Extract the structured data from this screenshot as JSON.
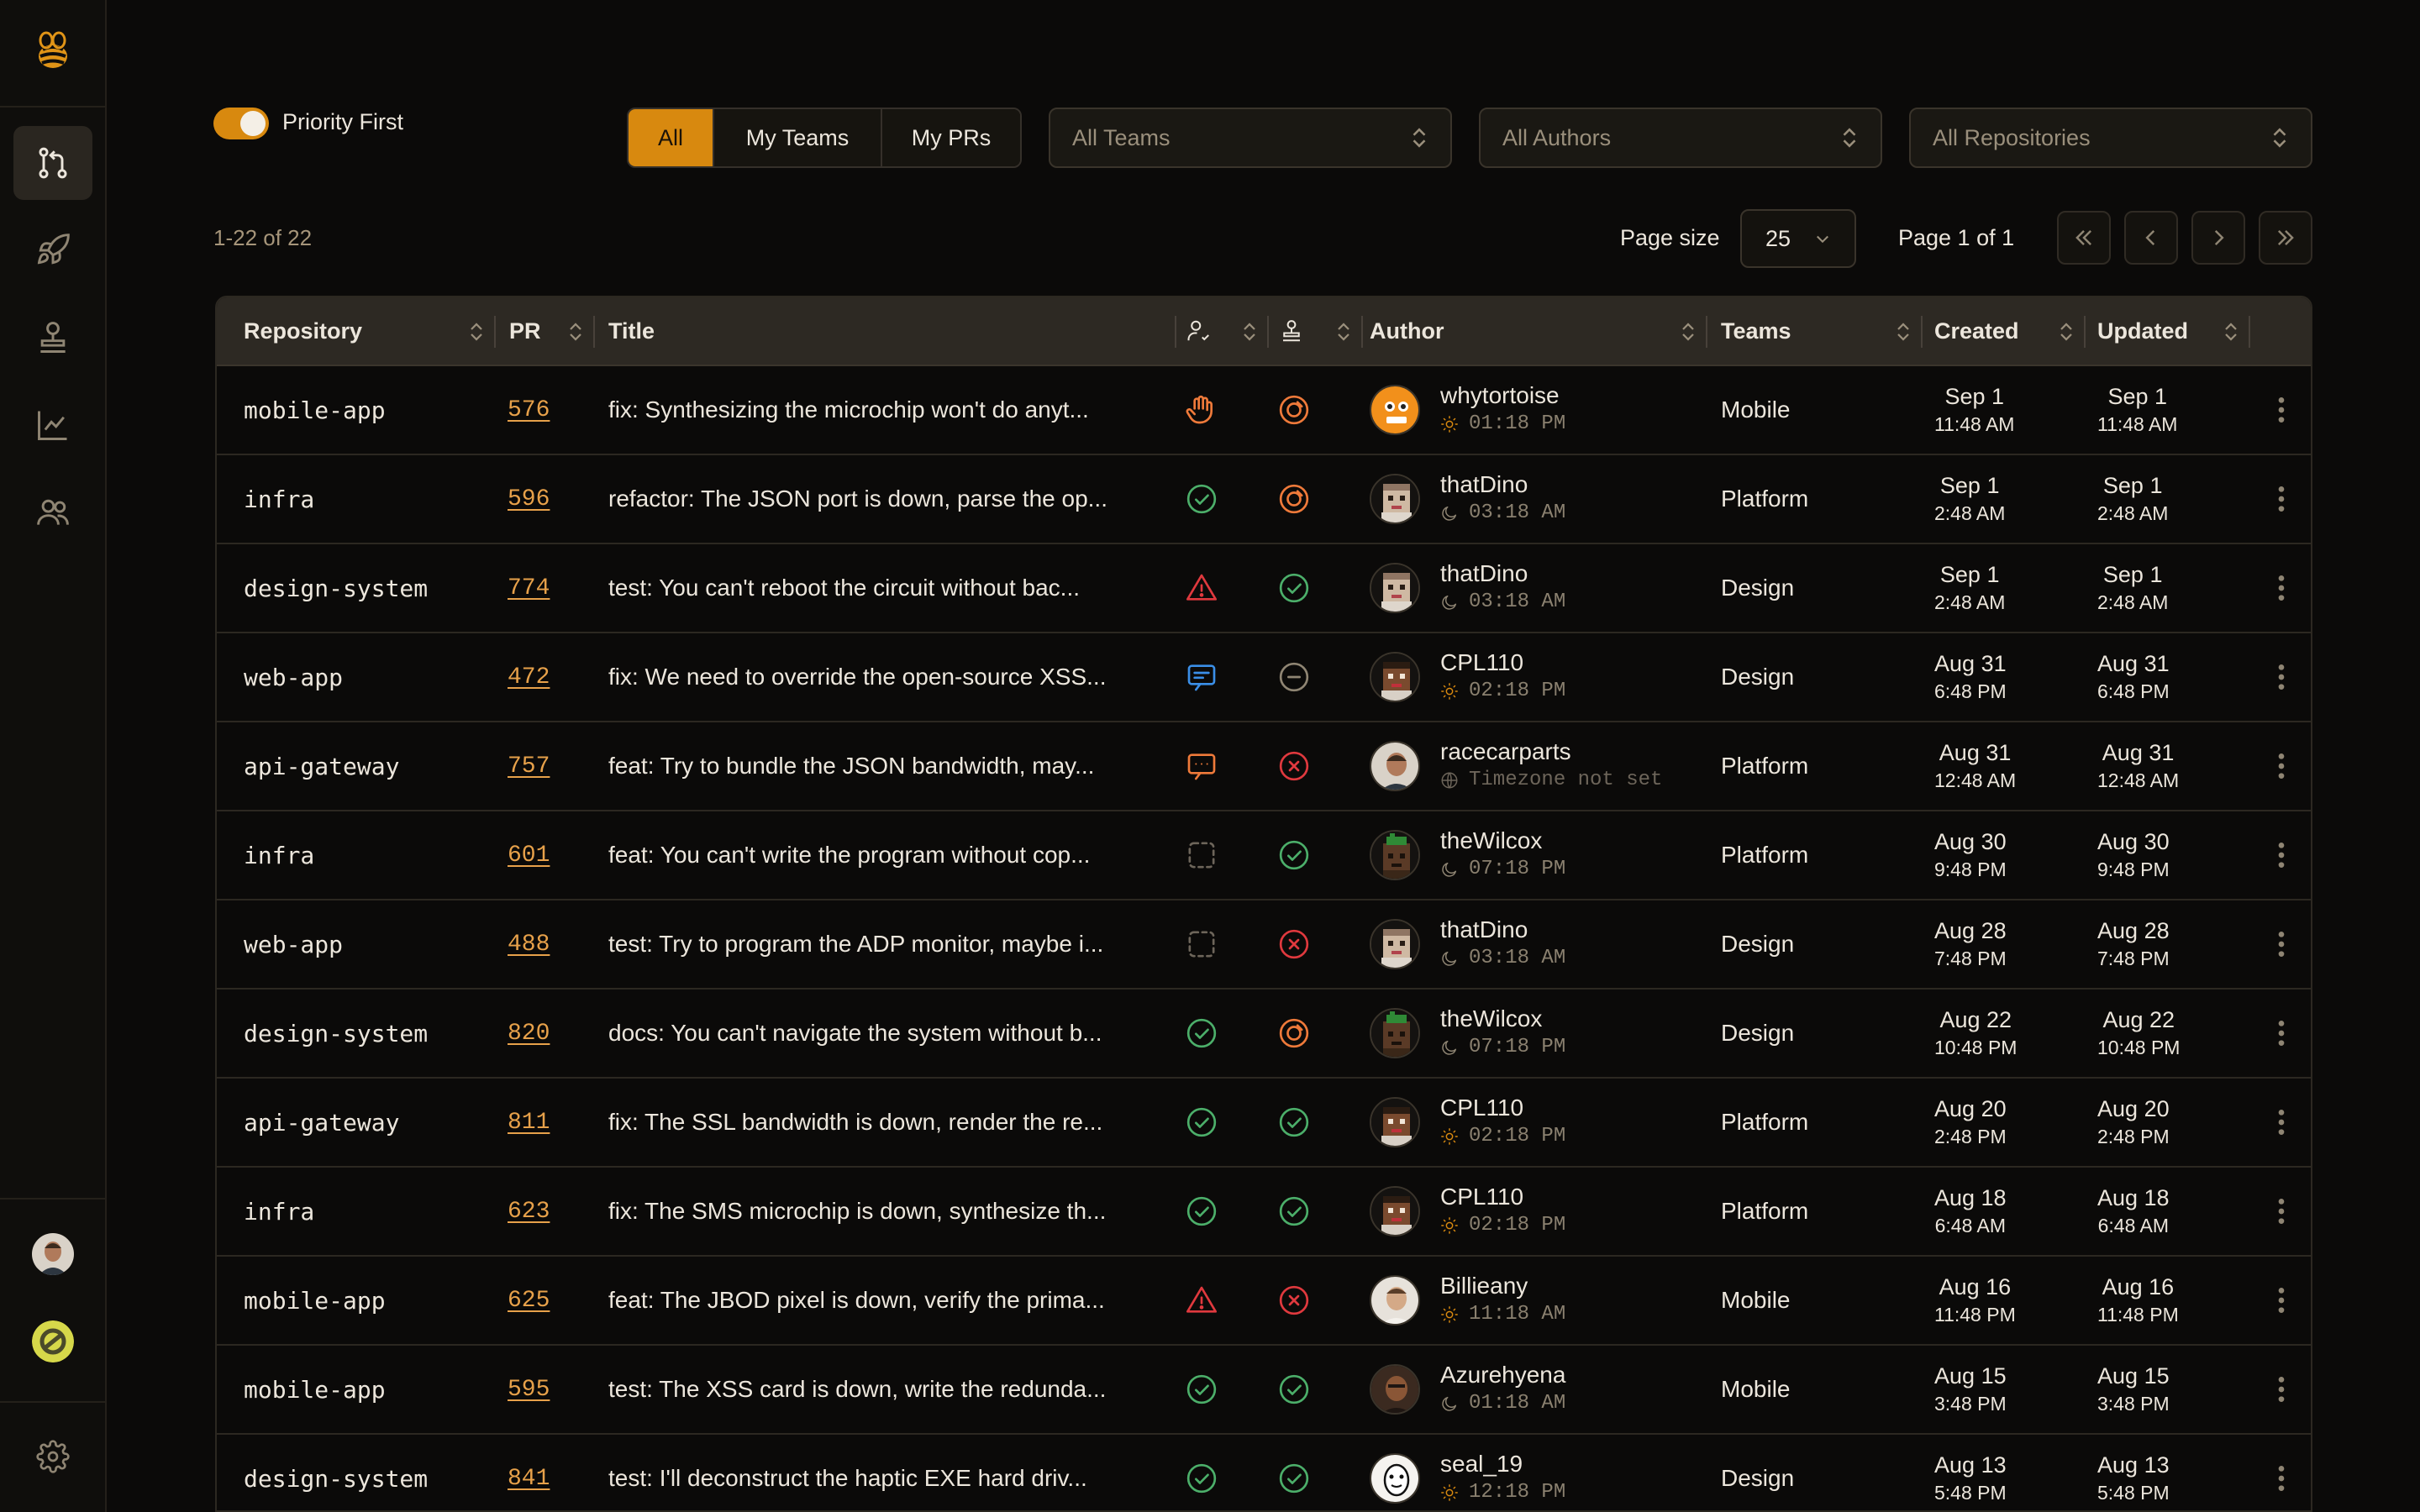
{
  "toolbar": {
    "priority_label": "Priority First",
    "segments": [
      "All",
      "My Teams",
      "My PRs"
    ],
    "teams_select": "All Teams",
    "authors_select": "All Authors",
    "repos_select": "All Repositories"
  },
  "pagination": {
    "count": "1-22 of 22",
    "page_size_label": "Page size",
    "page_size": "25",
    "page_label": "Page 1 of 1"
  },
  "columns": {
    "repository": "Repository",
    "pr": "PR",
    "title": "Title",
    "author": "Author",
    "teams": "Teams",
    "created": "Created",
    "updated": "Updated"
  },
  "rows": [
    {
      "repo": "mobile-app",
      "pr": "576",
      "title": "fix: Synthesizing the microchip won't do anyt...",
      "review": "hand",
      "ci": "pending",
      "author": "whytortoise",
      "tz": "01:18 PM",
      "tz_icon": "sun",
      "avatar": "orange",
      "team": "Mobile",
      "created_d": "Sep 1",
      "created_t": "11:48 AM",
      "updated_d": "Sep 1",
      "updated_t": "11:48 AM"
    },
    {
      "repo": "infra",
      "pr": "596",
      "title": "refactor: The JSON port is down, parse the op...",
      "review": "approved",
      "ci": "pending",
      "author": "thatDino",
      "tz": "03:18 AM",
      "tz_icon": "moon",
      "avatar": "pixel-light",
      "team": "Platform",
      "created_d": "Sep 1",
      "created_t": "2:48 AM",
      "updated_d": "Sep 1",
      "updated_t": "2:48 AM"
    },
    {
      "repo": "design-system",
      "pr": "774",
      "title": "test: You can't reboot the circuit without bac...",
      "review": "warning",
      "ci": "passed",
      "author": "thatDino",
      "tz": "03:18 AM",
      "tz_icon": "moon",
      "avatar": "pixel-light",
      "team": "Design",
      "created_d": "Sep 1",
      "created_t": "2:48 AM",
      "updated_d": "Sep 1",
      "updated_t": "2:48 AM"
    },
    {
      "repo": "web-app",
      "pr": "472",
      "title": "fix: We need to override the open-source XSS...",
      "review": "comment-blue",
      "ci": "neutral",
      "author": "CPL110",
      "tz": "02:18 PM",
      "tz_icon": "sun",
      "avatar": "pixel-dark",
      "team": "Design",
      "created_d": "Aug 31",
      "created_t": "6:48 PM",
      "updated_d": "Aug 31",
      "updated_t": "6:48 PM"
    },
    {
      "repo": "api-gateway",
      "pr": "757",
      "title": "feat: Try to bundle the JSON bandwidth, may...",
      "review": "comment-orange",
      "ci": "failed",
      "author": "racecarparts",
      "tz": "Timezone not set",
      "tz_icon": "globe",
      "avatar": "photo",
      "team": "Platform",
      "created_d": "Aug 31",
      "created_t": "12:48 AM",
      "updated_d": "Aug 31",
      "updated_t": "12:48 AM"
    },
    {
      "repo": "infra",
      "pr": "601",
      "title": "feat: You can't write the program without cop...",
      "review": "none",
      "ci": "passed",
      "author": "theWilcox",
      "tz": "07:18 PM",
      "tz_icon": "moon",
      "avatar": "pixel-green",
      "team": "Platform",
      "created_d": "Aug 30",
      "created_t": "9:48 PM",
      "updated_d": "Aug 30",
      "updated_t": "9:48 PM"
    },
    {
      "repo": "web-app",
      "pr": "488",
      "title": "test: Try to program the ADP monitor, maybe i...",
      "review": "none",
      "ci": "failed",
      "author": "thatDino",
      "tz": "03:18 AM",
      "tz_icon": "moon",
      "avatar": "pixel-light",
      "team": "Design",
      "created_d": "Aug 28",
      "created_t": "7:48 PM",
      "updated_d": "Aug 28",
      "updated_t": "7:48 PM"
    },
    {
      "repo": "design-system",
      "pr": "820",
      "title": "docs: You can't navigate the system without b...",
      "review": "approved",
      "ci": "pending",
      "author": "theWilcox",
      "tz": "07:18 PM",
      "tz_icon": "moon",
      "avatar": "pixel-green",
      "team": "Design",
      "created_d": "Aug 22",
      "created_t": "10:48 PM",
      "updated_d": "Aug 22",
      "updated_t": "10:48 PM"
    },
    {
      "repo": "api-gateway",
      "pr": "811",
      "title": "fix: The SSL bandwidth is down, render the re...",
      "review": "approved",
      "ci": "passed",
      "author": "CPL110",
      "tz": "02:18 PM",
      "tz_icon": "sun",
      "avatar": "pixel-dark",
      "team": "Platform",
      "created_d": "Aug 20",
      "created_t": "2:48 PM",
      "updated_d": "Aug 20",
      "updated_t": "2:48 PM"
    },
    {
      "repo": "infra",
      "pr": "623",
      "title": "fix: The SMS microchip is down, synthesize th...",
      "review": "approved",
      "ci": "passed",
      "author": "CPL110",
      "tz": "02:18 PM",
      "tz_icon": "sun",
      "avatar": "pixel-dark",
      "team": "Platform",
      "created_d": "Aug 18",
      "created_t": "6:48 AM",
      "updated_d": "Aug 18",
      "updated_t": "6:48 AM"
    },
    {
      "repo": "mobile-app",
      "pr": "625",
      "title": "feat: The JBOD pixel is down, verify the prima...",
      "review": "warning",
      "ci": "failed",
      "author": "Billieany",
      "tz": "11:18 AM",
      "tz_icon": "sun",
      "avatar": "photo-light",
      "team": "Mobile",
      "created_d": "Aug 16",
      "created_t": "11:48 PM",
      "updated_d": "Aug 16",
      "updated_t": "11:48 PM"
    },
    {
      "repo": "mobile-app",
      "pr": "595",
      "title": "test: The XSS card is down, write the redunda...",
      "review": "approved",
      "ci": "passed",
      "author": "Azurehyena",
      "tz": "01:18 AM",
      "tz_icon": "moon",
      "avatar": "photo-dark",
      "team": "Mobile",
      "created_d": "Aug 15",
      "created_t": "3:48 PM",
      "updated_d": "Aug 15",
      "updated_t": "3:48 PM"
    },
    {
      "repo": "design-system",
      "pr": "841",
      "title": "test: I'll deconstruct the haptic EXE hard driv...",
      "review": "approved",
      "ci": "passed",
      "author": "seal_19",
      "tz": "12:18 PM",
      "tz_icon": "sun",
      "avatar": "seal",
      "team": "Design",
      "created_d": "Aug 13",
      "created_t": "5:48 PM",
      "updated_d": "Aug 13",
      "updated_t": "5:48 PM"
    }
  ]
}
